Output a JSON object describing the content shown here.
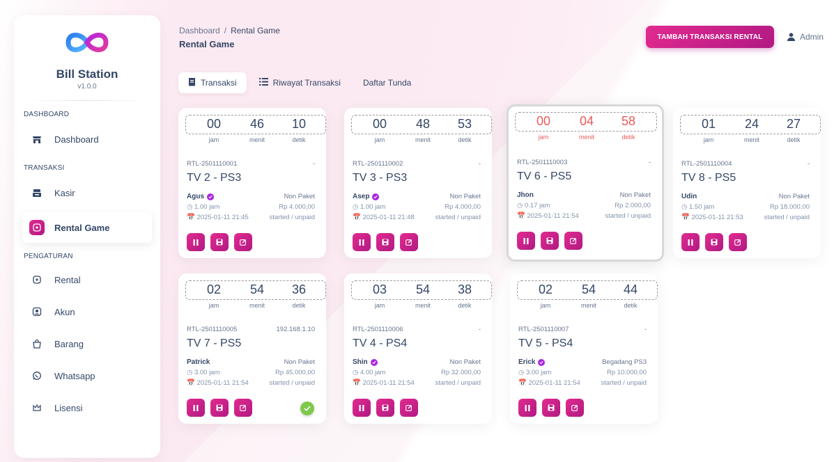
{
  "app": {
    "name": "Bill Station",
    "version": "v1.0.0"
  },
  "sidebar": {
    "sections": [
      {
        "label": "DASHBOARD",
        "items": [
          {
            "label": "Dashboard",
            "icon": "store-icon"
          }
        ]
      },
      {
        "label": "TRANSAKSI",
        "items": [
          {
            "label": "Kasir",
            "icon": "cash-register-icon"
          },
          {
            "label": "Rental Game",
            "icon": "gamepad-icon",
            "active": true
          }
        ]
      },
      {
        "label": "PENGATURAN",
        "items": [
          {
            "label": "Rental",
            "icon": "gamepad-outline-icon"
          },
          {
            "label": "Akun",
            "icon": "user-circle-icon"
          },
          {
            "label": "Barang",
            "icon": "shopping-bag-icon"
          },
          {
            "label": "Whatsapp",
            "icon": "whatsapp-icon"
          },
          {
            "label": "Lisensi",
            "icon": "crown-icon"
          }
        ]
      }
    ]
  },
  "header": {
    "breadcrumb_root": "Dashboard",
    "breadcrumb_sep": "/",
    "breadcrumb_current": "Rental Game",
    "title": "Rental Game",
    "add_button": "TAMBAH TRANSAKSI RENTAL",
    "user": "Admin"
  },
  "tabs": [
    {
      "label": "Transaksi",
      "active": true
    },
    {
      "label": "Riwayat Transaksi"
    },
    {
      "label": "Daftar Tunda"
    }
  ],
  "timer_labels": {
    "h": "jam",
    "m": "menit",
    "s": "detik"
  },
  "colors": {
    "accent": "#c81f88",
    "warning": "#ea5a5a",
    "success": "#7ec94b"
  },
  "cards": [
    {
      "h": "00",
      "m": "46",
      "s": "10",
      "id": "RTL-2501110001",
      "ip": "-",
      "name": "TV 2 - PS3",
      "customer": "Agus",
      "verified": true,
      "paket": "Non Paket",
      "duration": "1.00 jam",
      "price": "Rp 4.000,00",
      "date": "2025-01-11 21:45",
      "status": "started / unpaid"
    },
    {
      "h": "00",
      "m": "48",
      "s": "53",
      "id": "RTL-2501110002",
      "ip": "-",
      "name": "TV 3 - PS3",
      "customer": "Asep",
      "verified": true,
      "paket": "Non Paket",
      "duration": "1.00 jam",
      "price": "Rp 4.000,00",
      "date": "2025-01-11 21:48",
      "status": "started / unpaid"
    },
    {
      "h": "00",
      "m": "04",
      "s": "58",
      "id": "RTL-2501110003",
      "ip": "-",
      "name": "TV 6 - PS5",
      "customer": "Jhon",
      "verified": false,
      "paket": "Non Paket",
      "duration": "0.17 jam",
      "price": "Rp 2.000,00",
      "date": "2025-01-11 21:54",
      "status": "started / unpaid",
      "warning": true
    },
    {
      "h": "01",
      "m": "24",
      "s": "27",
      "id": "RTL-2501110004",
      "ip": "-",
      "name": "TV 8 - PS5",
      "customer": "Udin",
      "verified": false,
      "paket": "Non Paket",
      "duration": "1.50 jam",
      "price": "Rp 18.000,00",
      "date": "2025-01-11 21:53",
      "status": "started / unpaid"
    },
    {
      "h": "02",
      "m": "54",
      "s": "36",
      "id": "RTL-2501110005",
      "ip": "192.168.1.10",
      "name": "TV 7 - PS5",
      "customer": "Patrick",
      "verified": false,
      "paket": "Non Paket",
      "duration": "3.00 jam",
      "price": "Rp 45.000,00",
      "date": "2025-01-11 21:54",
      "status": "started / unpaid",
      "connected": true
    },
    {
      "h": "03",
      "m": "54",
      "s": "38",
      "id": "RTL-2501110006",
      "ip": "-",
      "name": "TV 4 - PS4",
      "customer": "Shin",
      "verified": true,
      "paket": "Non Paket",
      "duration": "4.00 jam",
      "price": "Rp 32.000,00",
      "date": "2025-01-11 21:54",
      "status": "started / unpaid"
    },
    {
      "h": "02",
      "m": "54",
      "s": "44",
      "id": "RTL-2501110007",
      "ip": "-",
      "name": "TV 5 - PS4",
      "customer": "Erick",
      "verified": true,
      "paket": "Begadang PS3",
      "duration": "3.00 jam",
      "price": "Rp 10.000,00",
      "date": "2025-01-11 21:54",
      "status": "started / unpaid"
    }
  ]
}
